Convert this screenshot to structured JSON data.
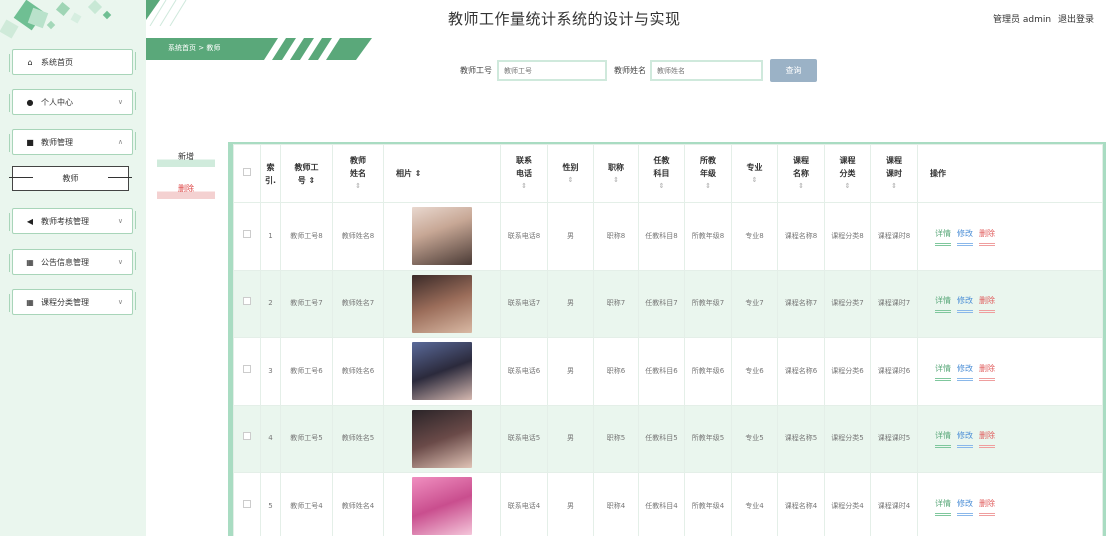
{
  "header": {
    "title": "教师工作量统计系统的设计与实现",
    "user_label": "管理员 admin",
    "logout_label": "退出登录",
    "breadcrumb": "系统首页 > 教师"
  },
  "sidebar": {
    "items": [
      {
        "label": "系统首页",
        "icon": "home-icon",
        "glyph": "⌂",
        "chev": ""
      },
      {
        "label": "个人中心",
        "icon": "user-icon",
        "glyph": "●",
        "chev": "∨"
      },
      {
        "label": "教师管理",
        "icon": "teacher-icon",
        "glyph": "■",
        "chev": "∧"
      },
      {
        "label": "教师考核管理",
        "icon": "send-icon",
        "glyph": "◀",
        "chev": "∨"
      },
      {
        "label": "公告信息管理",
        "icon": "grid-icon",
        "glyph": "▦",
        "chev": "∨"
      },
      {
        "label": "课程分类管理",
        "icon": "grid-icon",
        "glyph": "▦",
        "chev": "∨"
      }
    ],
    "submenu_label": "教师"
  },
  "search": {
    "id_label": "教师工号",
    "id_placeholder": "教师工号",
    "name_label": "教师姓名",
    "name_placeholder": "教师姓名",
    "button_label": "查询"
  },
  "actions": {
    "add_label": "新增",
    "delete_label": "删除"
  },
  "table": {
    "sort_glyph": "⇕",
    "headers": [
      "索引",
      "教师工号",
      "教师姓名",
      "相片",
      "联系电话",
      "性别",
      "职称",
      "任教科目",
      "所教年级",
      "专业",
      "课程名称",
      "课程分类",
      "课程课时",
      "操作"
    ],
    "header_display": [
      "索\n引.",
      "教师工\n号 ⇕",
      "教师\n姓名",
      "相片 ⇕",
      "联系\n电话",
      "性别",
      "职称",
      "任教\n科目",
      "所教\n年级",
      "专业",
      "课程\n名称",
      "课程\n分类",
      "课程\n课时",
      "操作"
    ],
    "op_labels": {
      "detail": "详情",
      "edit": "修改",
      "delete": "删除"
    },
    "rows": [
      {
        "index": "1",
        "id": "教师工号8",
        "name": "教师姓名8",
        "phone": "联系电话8",
        "gender": "男",
        "title": "职称8",
        "subject": "任教科目8",
        "grade": "所教年级8",
        "major": "专业8",
        "course": "课程名称8",
        "category": "课程分类8",
        "hours": "课程课时8"
      },
      {
        "index": "2",
        "id": "教师工号7",
        "name": "教师姓名7",
        "phone": "联系电话7",
        "gender": "男",
        "title": "职称7",
        "subject": "任教科目7",
        "grade": "所教年级7",
        "major": "专业7",
        "course": "课程名称7",
        "category": "课程分类7",
        "hours": "课程课时7"
      },
      {
        "index": "3",
        "id": "教师工号6",
        "name": "教师姓名6",
        "phone": "联系电话6",
        "gender": "男",
        "title": "职称6",
        "subject": "任教科目6",
        "grade": "所教年级6",
        "major": "专业6",
        "course": "课程名称6",
        "category": "课程分类6",
        "hours": "课程课时6"
      },
      {
        "index": "4",
        "id": "教师工号5",
        "name": "教师姓名5",
        "phone": "联系电话5",
        "gender": "男",
        "title": "职称5",
        "subject": "任教科目5",
        "grade": "所教年级5",
        "major": "专业5",
        "course": "课程名称5",
        "category": "课程分类5",
        "hours": "课程课时5"
      },
      {
        "index": "5",
        "id": "教师工号4",
        "name": "教师姓名4",
        "phone": "联系电话4",
        "gender": "男",
        "title": "职称4",
        "subject": "任教科目4",
        "grade": "所教年级4",
        "major": "专业4",
        "course": "课程名称4",
        "category": "课程分类4",
        "hours": "课程课时4"
      }
    ]
  },
  "colors": {
    "accent": "#5aa87a",
    "sidebar_bg": "#eaf6ee",
    "alt_row": "#eaf6ee",
    "search_button": "#9bb2c6",
    "delete": "#e05c5c",
    "edit": "#4b8ed6"
  }
}
